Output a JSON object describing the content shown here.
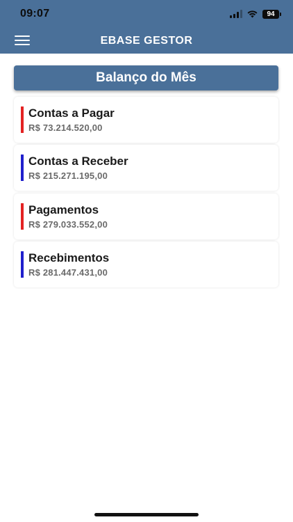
{
  "status_bar": {
    "time": "09:07",
    "battery": "94",
    "icons": [
      "cellular-signal-icon",
      "wifi-icon",
      "battery-icon"
    ]
  },
  "app_bar": {
    "title": "EBASE GESTOR",
    "menu_icon": "hamburger-menu-icon",
    "background_color": "#4a7099"
  },
  "section": {
    "title": "Balanço do Mês"
  },
  "cards": [
    {
      "title": "Contas a Pagar",
      "value": "R$ 73.214.520,00",
      "accent": "red"
    },
    {
      "title": "Contas a Receber",
      "value": "R$ 215.271.195,00",
      "accent": "blue"
    },
    {
      "title": "Pagamentos",
      "value": "R$ 279.033.552,00",
      "accent": "red"
    },
    {
      "title": "Recebimentos",
      "value": "R$ 281.447.431,00",
      "accent": "blue"
    }
  ],
  "colors": {
    "red_accent": "#e32222",
    "blue_accent": "#1f1fcc"
  }
}
